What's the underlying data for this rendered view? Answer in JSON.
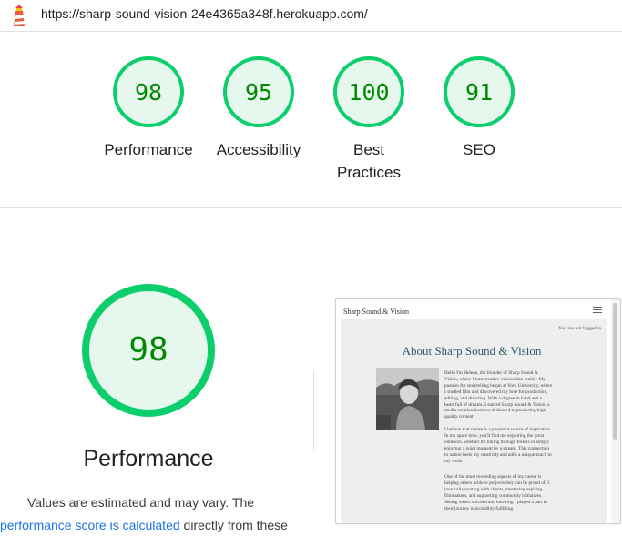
{
  "url_bar": {
    "url": "https://sharp-sound-vision-24e4365a348f.herokuapp.com/",
    "logo_icon": "lighthouse-icon"
  },
  "scores": [
    {
      "label": "Performance",
      "value": 98,
      "color": "#0cce6b"
    },
    {
      "label": "Accessibility",
      "value": 95,
      "color": "#0cce6b"
    },
    {
      "label": "Best Practices",
      "value": 100,
      "color": "#0cce6b"
    },
    {
      "label": "SEO",
      "value": 91,
      "color": "#0cce6b"
    }
  ],
  "colors": {
    "pass": "#0cce6b",
    "pass_text": "#008800",
    "pass_bg": "#e6f8ee",
    "link": "#1a73e8"
  },
  "detail": {
    "score": "98",
    "score_value": 98,
    "title": "Performance",
    "desc_line1": "Values are estimated and may vary. The",
    "desc_link": "performance score is calculated",
    "desc_line2_rest": " directly from these"
  },
  "thumbnail": {
    "brand": "Sharp Sound & Vision",
    "menu_icon": "hamburger-icon",
    "login_status": "You are not logged in",
    "heading": "About Sharp Sound & Vision",
    "paragraphs": [
      [
        "Hello I'm Helena, the founder of Sharp Sound &",
        "Vision, where I turn creative visions into reality. My",
        "passion for storytelling began at York University, where",
        "I studied film and discovered my love for production,",
        "editing, and directing. With a degree in hand and a",
        "heart full of dreams, I started Sharp Sound & Vision, a",
        "media creation business dedicated to producing high-",
        "quality content."
      ],
      [
        "I believe that nature is a powerful source of inspiration.",
        "In my spare time, you'll find me exploring the great",
        "outdoors, whether it's hiking through forests or simply",
        "enjoying a quiet moment by a stream. This connection",
        "to nature fuels my creativity and adds a unique touch to",
        "my work."
      ],
      [
        "One of the most rewarding aspects of my career is",
        "helping others achieve projects they can be proud of. I",
        "love collaborating with clients, mentoring aspiring",
        "filmmakers, and supporting community initiatives.",
        "Seeing others succeed and knowing I played a part in",
        "their journey is incredibly fulfilling."
      ]
    ]
  }
}
